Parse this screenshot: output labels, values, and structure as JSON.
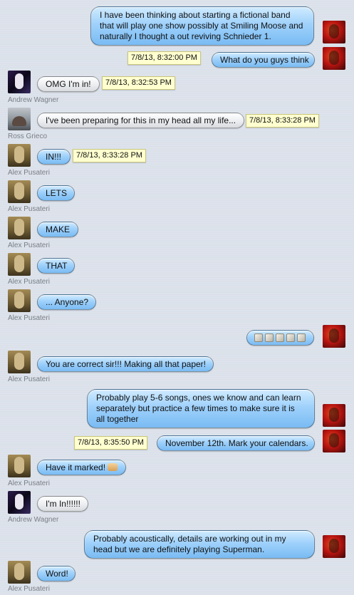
{
  "messages": [
    {
      "id": "m1",
      "side": "me",
      "text": "I have been thinking about starting a fictional band that will play one show possibly at Smiling Moose and naturally I thought a out reviving Schnieder 1."
    },
    {
      "id": "m2",
      "side": "me",
      "text": "What do you guys think",
      "timestamp": "7/8/13, 8:32:00 PM"
    },
    {
      "id": "m3",
      "side": "them",
      "text": "OMG I'm in!",
      "timestamp": "7/8/13, 8:32:53 PM",
      "sender": "Andrew Wagner"
    },
    {
      "id": "m4",
      "side": "them",
      "text": "I've been preparing for this in my head all my life...",
      "timestamp": "7/8/13, 8:33:28 PM",
      "sender": "Ross Grieco"
    },
    {
      "id": "m5",
      "side": "them",
      "text": "IN!!!",
      "timestamp": "7/8/13, 8:33:28 PM",
      "sender": "Alex Pusateri"
    },
    {
      "id": "m6",
      "side": "them",
      "text": "LETS",
      "sender": "Alex Pusateri"
    },
    {
      "id": "m7",
      "side": "them",
      "text": "MAKE",
      "sender": "Alex Pusateri"
    },
    {
      "id": "m8",
      "side": "them",
      "text": "THAT",
      "sender": "Alex Pusateri"
    },
    {
      "id": "m9",
      "side": "them",
      "text": "... Anyone?",
      "sender": "Alex Pusateri"
    },
    {
      "id": "m10",
      "side": "me",
      "emoji": "sparkle-emoji",
      "count": 5
    },
    {
      "id": "m11",
      "side": "them",
      "text": "You are correct sir!!! Making all that paper!",
      "sender": "Alex Pusateri"
    },
    {
      "id": "m12",
      "side": "me",
      "text": "Probably play 5-6 songs, ones we know and can learn separately but practice a few times to make sure it is all together"
    },
    {
      "id": "m13",
      "side": "me",
      "text": "November 12th. Mark your calendars.",
      "timestamp": "7/8/13, 8:35:50 PM"
    },
    {
      "id": "m14",
      "side": "them",
      "text": "Have it marked!",
      "emoji": "thumbs-up-emoji",
      "sender": "Alex Pusateri"
    },
    {
      "id": "m15",
      "side": "them",
      "text": "I'm In!!!!!!",
      "sender": "Andrew Wagner"
    },
    {
      "id": "m16",
      "side": "me",
      "text": "Probably acoustically, details are working out in my head but we are definitely playing Superman."
    },
    {
      "id": "m17",
      "side": "them",
      "text": "Word!",
      "sender": "Alex Pusateri"
    }
  ]
}
